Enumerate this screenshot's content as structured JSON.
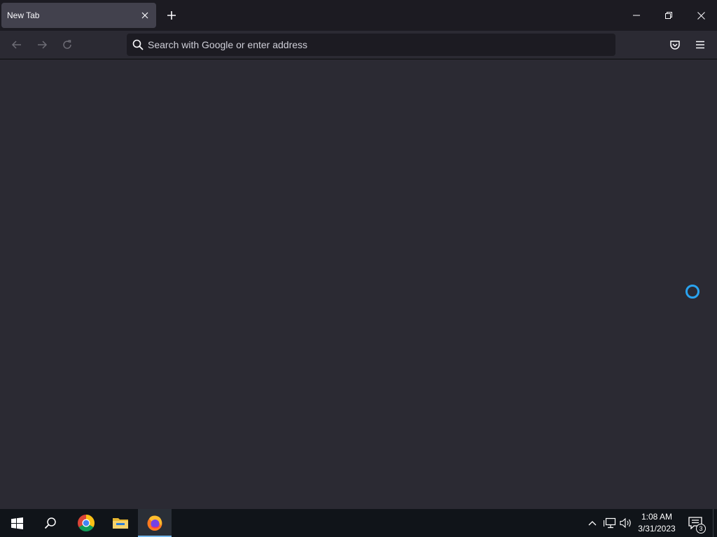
{
  "browser": {
    "tabs": [
      {
        "title": "New Tab",
        "active": true
      }
    ],
    "urlbar": {
      "value": "",
      "placeholder": "Search with Google or enter address"
    }
  },
  "taskbar": {
    "pinned": [
      {
        "name": "start",
        "icon": "windows-logo-icon"
      },
      {
        "name": "search",
        "icon": "search-icon"
      },
      {
        "name": "chrome",
        "icon": "chrome-icon"
      },
      {
        "name": "file-explorer",
        "icon": "folder-icon"
      },
      {
        "name": "firefox",
        "icon": "firefox-icon",
        "active": true
      }
    ],
    "clock": {
      "time": "1:08 AM",
      "date": "3/31/2023"
    },
    "notifications": {
      "count": "3"
    }
  },
  "colors": {
    "tab_strip_bg": "#1c1b22",
    "active_tab_bg": "#42414d",
    "toolbar_bg": "#2b2a33",
    "urlbar_bg": "#1c1b22",
    "spinner": "#29a3f0",
    "taskbar_bg": "#101419"
  }
}
